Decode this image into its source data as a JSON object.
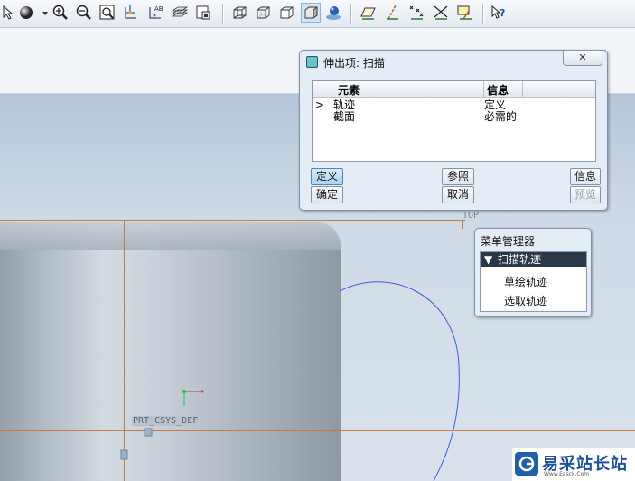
{
  "toolbar": {
    "icons": [
      "mouse-select-icon",
      "shading-sphere-icon",
      "zoom-in-icon",
      "zoom-out-icon",
      "zoom-fit-icon",
      "spin-center-icon",
      "annotation-icon",
      "layers-icon",
      "view-manager-icon",
      "wireframe-cube-icon",
      "hidden-line-cube-icon",
      "no-hidden-cube-icon",
      "shaded-cube-icon",
      "appearance-icon",
      "datum-plane-icon",
      "datum-axis-icon",
      "datum-point-icon",
      "csys-icon",
      "datum-display-icon",
      "whats-this-help-icon"
    ]
  },
  "dialog": {
    "title": "伸出项: 扫描",
    "close_label": "",
    "columns": [
      "元素",
      "信息"
    ],
    "rows": [
      {
        "marker": ">",
        "element": "轨迹",
        "info": "定义"
      },
      {
        "marker": "",
        "element": "截面",
        "info": "必需的"
      }
    ],
    "buttons": {
      "define": "定义",
      "reference": "参照",
      "info": "信息",
      "ok": "确定",
      "cancel": "取消",
      "preview": "预览"
    }
  },
  "menu_manager": {
    "title": "菜单管理器",
    "header": "扫描轨迹",
    "items": [
      "草绘轨迹",
      "选取轨迹"
    ]
  },
  "viewport": {
    "datum_plane_label": "TOP",
    "csys_label": "PRT_CSYS_DEF"
  },
  "watermark": {
    "text": "易采站长站",
    "subtext": "Www.Easck.Com"
  },
  "colors": {
    "dialog_bg": "#e4ecf5",
    "selected_button": "#a9d4ee",
    "menu_header": "#2b3845",
    "datum": "#c07c4a",
    "sketch_curve": "#3b5fd6"
  }
}
